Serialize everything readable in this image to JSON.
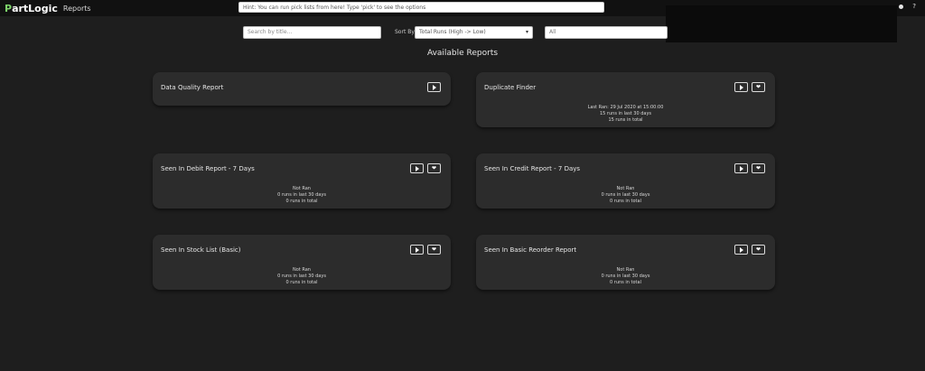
{
  "header": {
    "brand_p": "P",
    "brand_rest": "artLogic",
    "page": "Reports",
    "hint": "Hint: You can run pick lists from here! Type 'pick' to see the options",
    "help": "?"
  },
  "filters": {
    "search_placeholder": "Search by title...",
    "sort_label": "Sort By",
    "sort_value": "Total Runs (High -> Low)",
    "filter_value": "All"
  },
  "section_title": "Available Reports",
  "cards": [
    {
      "title": "Data Quality Report",
      "stats": []
    },
    {
      "title": "Duplicate Finder",
      "stats": [
        "Last Ran: 29 Jul 2020 at 15:00:00",
        "15 runs in last 30 days",
        "15 runs in total"
      ]
    },
    {
      "title": "Seen In Debit Report - 7 Days",
      "stats": [
        "Not Ran",
        "0 runs in last 30 days",
        "0 runs in total"
      ]
    },
    {
      "title": "Seen In Credit Report - 7 Days",
      "stats": [
        "Not Ran",
        "0 runs in last 30 days",
        "0 runs in total"
      ]
    },
    {
      "title": "Seen In Stock List (Basic)",
      "stats": [
        "Not Ran",
        "0 runs in last 30 days",
        "0 runs in total"
      ]
    },
    {
      "title": "Seen In Basic Reorder Report",
      "stats": [
        "Not Ran",
        "0 runs in last 30 days",
        "0 runs in total"
      ]
    }
  ]
}
